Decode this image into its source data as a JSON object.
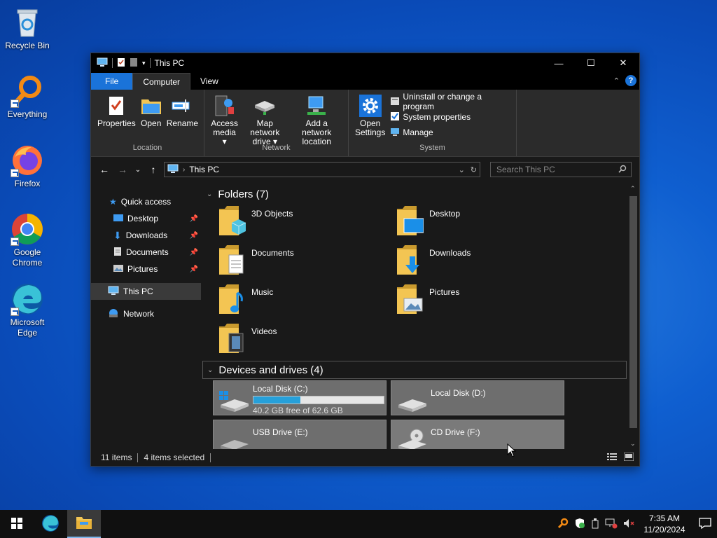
{
  "desktop": {
    "icons": [
      {
        "label": "Recycle Bin",
        "icon": "recycle-bin-icon"
      },
      {
        "label": "Everything",
        "icon": "everything-search-icon"
      },
      {
        "label": "Firefox",
        "icon": "firefox-icon"
      },
      {
        "label": "Google Chrome",
        "icon": "chrome-icon"
      },
      {
        "label": "Microsoft Edge",
        "icon": "edge-icon"
      }
    ]
  },
  "window": {
    "title": "This PC",
    "controls": {
      "minimize": "—",
      "maximize": "☐",
      "close": "✕"
    },
    "tabs": {
      "file": "File",
      "computer": "Computer",
      "view": "View"
    },
    "help": "?",
    "ribbon": {
      "location": {
        "name": "Location",
        "properties": "Properties",
        "open": "Open",
        "rename": "Rename"
      },
      "network": {
        "name": "Network",
        "access_media_1": "Access",
        "access_media_2": "media ▾",
        "map_drive_1": "Map network",
        "map_drive_2": "drive ▾",
        "add_location_1": "Add a network",
        "add_location_2": "location"
      },
      "system": {
        "name": "System",
        "open_settings_1": "Open",
        "open_settings_2": "Settings",
        "uninstall": "Uninstall or change a program",
        "sys_props": "System properties",
        "manage": "Manage"
      }
    },
    "address": {
      "path": "This PC",
      "search_placeholder": "Search This PC"
    },
    "nav": {
      "quick_access": "Quick access",
      "desktop": "Desktop",
      "downloads": "Downloads",
      "documents": "Documents",
      "pictures": "Pictures",
      "this_pc": "This PC",
      "network": "Network"
    },
    "folders_header": "Folders (7)",
    "folders": {
      "objects3d": "3D Objects",
      "desktop": "Desktop",
      "documents": "Documents",
      "downloads": "Downloads",
      "music": "Music",
      "pictures": "Pictures",
      "videos": "Videos"
    },
    "drives_header": "Devices and drives (4)",
    "drives": {
      "c": {
        "label": "Local Disk (C:)",
        "free": "40.2 GB free of 62.6 GB",
        "used_fraction": 0.358
      },
      "d": {
        "label": "Local Disk (D:)"
      },
      "e": {
        "label": "USB Drive (E:)"
      },
      "f": {
        "label": "CD Drive (F:)"
      }
    },
    "status": {
      "items": "11 items",
      "selected": "4 items selected"
    }
  },
  "taskbar": {
    "time": "7:35 AM",
    "date": "11/20/2024"
  },
  "colors": {
    "accent": "#1a73d9",
    "folder": "#f3c553",
    "drive_bar": "#26a0da"
  }
}
